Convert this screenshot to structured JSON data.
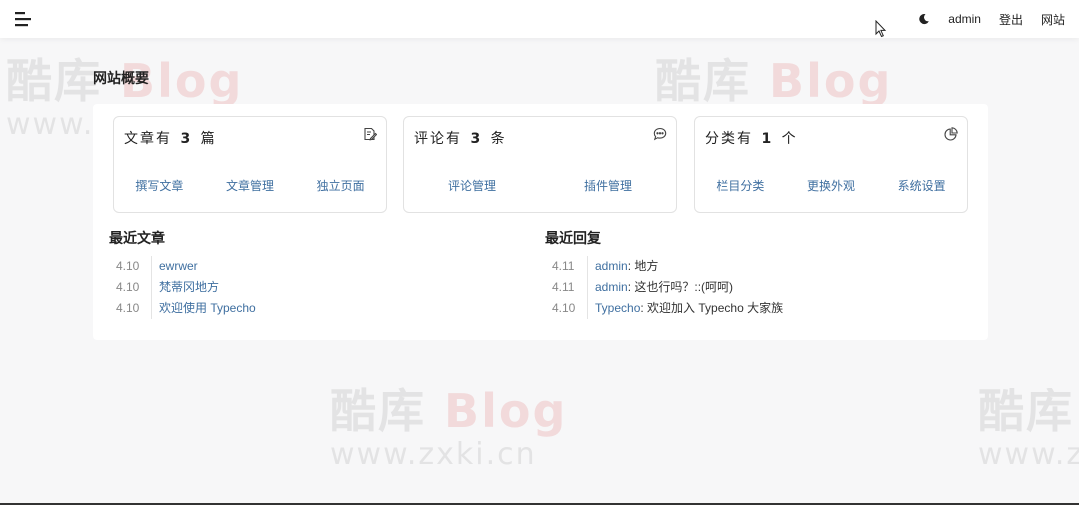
{
  "topbar": {
    "menu_icon": "hamburger-menu-icon",
    "theme_icon": "moon-icon",
    "user": "admin",
    "logout": "登出",
    "site": "网站"
  },
  "watermark": {
    "big_a": "酷库",
    "big_b": "Blog",
    "url": "www.zxki.cn"
  },
  "page": {
    "title": "网站概要"
  },
  "stats": [
    {
      "prefix": "文章有",
      "count": "3",
      "suffix": "篇",
      "icon": "edit-document-icon",
      "links": [
        "撰写文章",
        "文章管理",
        "独立页面"
      ]
    },
    {
      "prefix": "评论有",
      "count": "3",
      "suffix": "条",
      "icon": "comment-bubble-icon",
      "links": [
        "评论管理",
        "插件管理"
      ]
    },
    {
      "prefix": "分类有",
      "count": "1",
      "suffix": "个",
      "icon": "pie-chart-icon",
      "links": [
        "栏目分类",
        "更换外观",
        "系统设置"
      ]
    }
  ],
  "recent_posts": {
    "title": "最近文章",
    "items": [
      {
        "date": "4.10",
        "title": "ewrwer"
      },
      {
        "date": "4.10",
        "title": "梵蒂冈地方"
      },
      {
        "date": "4.10",
        "title": "欢迎使用 Typecho"
      }
    ]
  },
  "recent_replies": {
    "title": "最近回复",
    "items": [
      {
        "date": "4.11",
        "author": "admin",
        "text": "地方"
      },
      {
        "date": "4.11",
        "author": "admin",
        "text": "这也行吗？::(呵呵)"
      },
      {
        "date": "4.10",
        "author": "Typecho",
        "text": "欢迎加入 Typecho 大家族"
      }
    ]
  },
  "colors": {
    "link": "#3f6fa0",
    "background": "#f7f7f8",
    "panel": "#ffffff"
  }
}
